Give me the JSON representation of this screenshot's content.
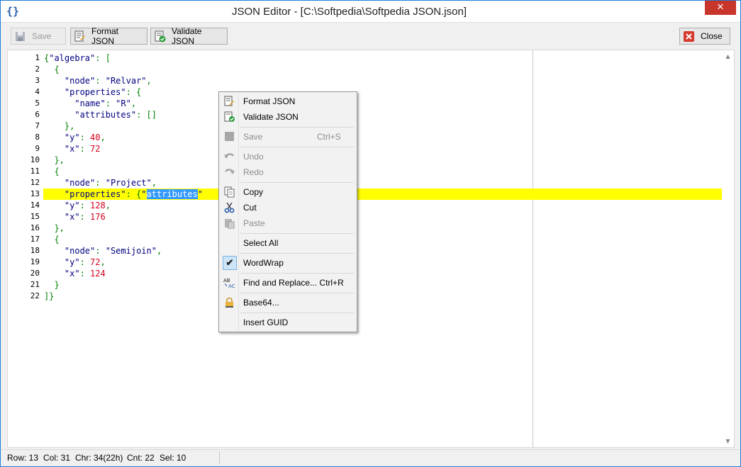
{
  "window": {
    "title": "JSON Editor - [C:\\Softpedia\\Softpedia JSON.json]",
    "close_glyph": "✕",
    "app_icon_glyph": "{}"
  },
  "toolbar": {
    "save_label": "Save",
    "format_label": "Format JSON",
    "validate_label": "Validate JSON",
    "close_label": "Close"
  },
  "editor": {
    "line_numbers": [
      "1",
      "2",
      "3",
      "4",
      "5",
      "6",
      "7",
      "8",
      "9",
      "10",
      "11",
      "12",
      "13",
      "14",
      "15",
      "16",
      "17",
      "18",
      "19",
      "20",
      "21",
      "22"
    ],
    "lines": [
      [
        [
          "p",
          "{"
        ],
        [
          "k",
          "\"algebra\""
        ],
        [
          "p",
          ": ["
        ]
      ],
      [
        [
          "p",
          "  {"
        ]
      ],
      [
        [
          "p",
          "    "
        ],
        [
          "k",
          "\"node\""
        ],
        [
          "p",
          ": "
        ],
        [
          "s",
          "\"Relvar\""
        ],
        [
          "p",
          ","
        ]
      ],
      [
        [
          "p",
          "    "
        ],
        [
          "k",
          "\"properties\""
        ],
        [
          "p",
          ": {"
        ]
      ],
      [
        [
          "p",
          "      "
        ],
        [
          "k",
          "\"name\""
        ],
        [
          "p",
          ": "
        ],
        [
          "s",
          "\"R\""
        ],
        [
          "p",
          ","
        ]
      ],
      [
        [
          "p",
          "      "
        ],
        [
          "k",
          "\"attributes\""
        ],
        [
          "p",
          ": []"
        ]
      ],
      [
        [
          "p",
          "    },"
        ]
      ],
      [
        [
          "p",
          "    "
        ],
        [
          "k",
          "\"y\""
        ],
        [
          "p",
          ": "
        ],
        [
          "n",
          "40"
        ],
        [
          "p",
          ","
        ]
      ],
      [
        [
          "p",
          "    "
        ],
        [
          "k",
          "\"x\""
        ],
        [
          "p",
          ": "
        ],
        [
          "n",
          "72"
        ]
      ],
      [
        [
          "p",
          "  },"
        ]
      ],
      [
        [
          "p",
          "  {"
        ]
      ],
      [
        [
          "p",
          "    "
        ],
        [
          "k",
          "\"node\""
        ],
        [
          "p",
          ": "
        ],
        [
          "s",
          "\"Project\""
        ],
        [
          "p",
          ","
        ]
      ],
      [
        [
          "p",
          "    "
        ],
        [
          "k",
          "\"properties\""
        ],
        [
          "p",
          ": {"
        ],
        [
          "k",
          "\""
        ],
        [
          "sel",
          "attributes"
        ],
        [
          "k",
          "\""
        ]
      ],
      [
        [
          "p",
          "    "
        ],
        [
          "k",
          "\"y\""
        ],
        [
          "p",
          ": "
        ],
        [
          "n",
          "128"
        ],
        [
          "p",
          ","
        ]
      ],
      [
        [
          "p",
          "    "
        ],
        [
          "k",
          "\"x\""
        ],
        [
          "p",
          ": "
        ],
        [
          "n",
          "176"
        ]
      ],
      [
        [
          "p",
          "  },"
        ]
      ],
      [
        [
          "p",
          "  {"
        ]
      ],
      [
        [
          "p",
          "    "
        ],
        [
          "k",
          "\"node\""
        ],
        [
          "p",
          ": "
        ],
        [
          "s",
          "\"Semijoin\""
        ],
        [
          "p",
          ","
        ]
      ],
      [
        [
          "p",
          "    "
        ],
        [
          "k",
          "\"y\""
        ],
        [
          "p",
          ": "
        ],
        [
          "n",
          "72"
        ],
        [
          "p",
          ","
        ]
      ],
      [
        [
          "p",
          "    "
        ],
        [
          "k",
          "\"x\""
        ],
        [
          "p",
          ": "
        ],
        [
          "n",
          "124"
        ]
      ],
      [
        [
          "p",
          "  }"
        ]
      ],
      [
        [
          "p",
          "]}"
        ]
      ]
    ],
    "highlighted_line": 13
  },
  "context_menu": {
    "items": [
      {
        "label": "Format JSON",
        "shortcut": "",
        "icon": "format-json-icon",
        "disabled": false
      },
      {
        "label": "Validate JSON",
        "shortcut": "",
        "icon": "validate-json-icon",
        "disabled": false
      },
      {
        "label": "Save",
        "shortcut": "Ctrl+S",
        "icon": "save-icon",
        "disabled": true
      },
      {
        "label": "Undo",
        "shortcut": "",
        "icon": "undo-icon",
        "disabled": true
      },
      {
        "label": "Redo",
        "shortcut": "",
        "icon": "redo-icon",
        "disabled": true
      },
      {
        "label": "Copy",
        "shortcut": "",
        "icon": "copy-icon",
        "disabled": false
      },
      {
        "label": "Cut",
        "shortcut": "",
        "icon": "cut-icon",
        "disabled": false
      },
      {
        "label": "Paste",
        "shortcut": "",
        "icon": "paste-icon",
        "disabled": true
      },
      {
        "label": "Select All",
        "shortcut": "",
        "icon": "",
        "disabled": false
      },
      {
        "label": "WordWrap",
        "shortcut": "",
        "icon": "check-icon",
        "disabled": false,
        "checked": true
      },
      {
        "label": "Find and Replace... Ctrl+R",
        "shortcut": "",
        "icon": "find-replace-icon",
        "disabled": false
      },
      {
        "label": "Base64...",
        "shortcut": "",
        "icon": "base64-lock-icon",
        "disabled": false
      },
      {
        "label": "Insert GUID",
        "shortcut": "",
        "icon": "",
        "disabled": false
      }
    ]
  },
  "statusbar": {
    "row": "Row: 13",
    "col": "Col: 31",
    "chr": "Chr: 34(22h)",
    "cnt": "Cnt: 22",
    "sel": "Sel: 10"
  },
  "colors": {
    "accent": "#1e7ed8",
    "highlight": "#ffff00",
    "selection": "#3399ff",
    "key": "#000080",
    "number": "#d4001a",
    "punct": "#008000",
    "close_red": "#c7352b"
  }
}
